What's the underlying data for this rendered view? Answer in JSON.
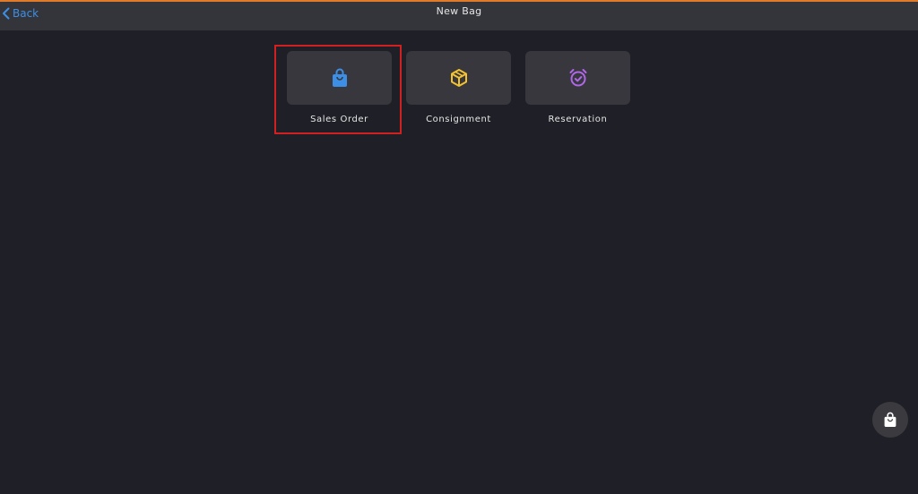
{
  "header": {
    "back_label": "Back",
    "title": "New Bag",
    "accent_color": "#e07b2a",
    "back_color": "#3d8fe6"
  },
  "options": [
    {
      "label": "Sales Order",
      "icon": "shopping-bag-icon",
      "icon_color": "#3d8fe6",
      "selected": true
    },
    {
      "label": "Consignment",
      "icon": "package-box-icon",
      "icon_color": "#f2c230",
      "selected": false
    },
    {
      "label": "Reservation",
      "icon": "alarm-clock-check-icon",
      "icon_color": "#b067e8",
      "selected": false
    }
  ],
  "fab": {
    "icon": "shopping-bag-icon"
  }
}
